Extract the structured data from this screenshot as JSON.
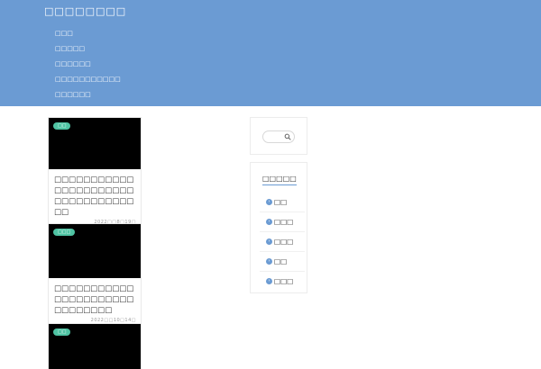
{
  "header": {
    "site_title": "□□□□□□□□",
    "nav": [
      "□□□",
      "□□□□□",
      "□□□□□□",
      "□□□□□□□□□□□",
      "□□□□□□"
    ]
  },
  "posts": [
    {
      "category": "□□",
      "title": "□□□□□□□□□□□□□□□□□□□□□□□□□□□□□□□□□□□",
      "date": "2022□□8□19□"
    },
    {
      "category": "□□□",
      "title": "□□□□□□□□□□□□□□□□□□□□□□□□□□□□□□",
      "date": "2022□□10□14□"
    },
    {
      "category": "□□",
      "title": "",
      "date": ""
    }
  ],
  "sidebar": {
    "search": {
      "placeholder": ""
    },
    "categories": {
      "title": "□□□□□",
      "items": [
        "□□",
        "□□□",
        "□□□",
        "□□",
        "□□□"
      ]
    }
  },
  "colors": {
    "header_bg": "#6b9bd3",
    "badge_bg": "#4fc3a3",
    "thumbnail_bg": "#000000"
  },
  "icons": {
    "search": "search-icon",
    "category_bullet": "chevron-right-icon"
  }
}
